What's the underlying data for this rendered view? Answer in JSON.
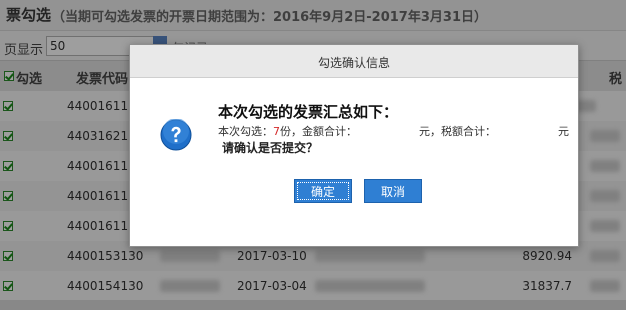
{
  "page": {
    "title": "票勾选",
    "subtitle": "（当期可勾选发票的开票日期范围为：2016年9月2日-2017年3月31日）"
  },
  "toolbar": {
    "per_page_label": "页显示",
    "per_page_value": "50",
    "right_text": "勾记录"
  },
  "table": {
    "headers": {
      "check": "勾选",
      "code": "发票代码",
      "tax": "税"
    },
    "rows": [
      {
        "code": "4400161130",
        "date": "",
        "amount": "",
        "checked": true
      },
      {
        "code": "4403162130",
        "date": "",
        "amount": "",
        "checked": true
      },
      {
        "code": "4400161130",
        "date": "",
        "amount": "",
        "checked": true
      },
      {
        "code": "4400161130",
        "date": "",
        "amount": "",
        "checked": true
      },
      {
        "code": "4400161130",
        "date": "",
        "amount": "",
        "checked": true
      },
      {
        "code": "4400153130",
        "date": "2017-03-10",
        "amount": "8920.94",
        "checked": true
      },
      {
        "code": "4400154130",
        "date": "2017-03-04",
        "amount": "31837.7",
        "checked": true
      }
    ]
  },
  "dialog": {
    "title": "勾选确认信息",
    "summary_title": "本次勾选的发票汇总如下：",
    "count_label": "本次勾选：",
    "count_value": "7",
    "count_unit": "份，金额合计：",
    "amount_unit": "元，税额合计：",
    "tax_unit": "元",
    "confirm_question": "请确认是否提交？",
    "ok_label": "确定",
    "cancel_label": "取消"
  },
  "colors": {
    "accent": "#2f7fd3",
    "highlight": "#d42a2a",
    "check": "#1a8c1a"
  },
  "icons": {
    "dialog": "question-icon",
    "row": "checkbox-checked-icon"
  }
}
